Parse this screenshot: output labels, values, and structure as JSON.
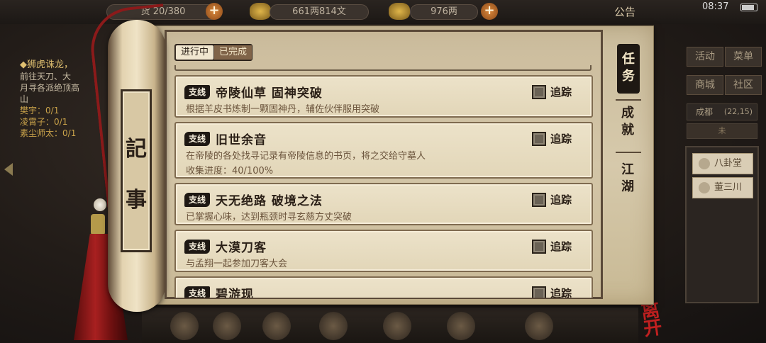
{
  "status_bar": {
    "time": "08:37"
  },
  "hud": {
    "stock_label": "货",
    "stock_value": "20/380",
    "money": "661两814文",
    "gold": "976两",
    "announcement": "公告"
  },
  "left_quest": {
    "title": "◆狮虎诛龙，",
    "desc_lines": [
      "前往天刀、大",
      "月寻各派绝顶高",
      "山"
    ],
    "counters": [
      {
        "label": "樊宇：",
        "value": "0/1"
      },
      {
        "label": "凌霄子：",
        "value": "0/1"
      },
      {
        "label": "素尘师太：",
        "value": "0/1"
      }
    ]
  },
  "right_menu": {
    "buttons": [
      "活动",
      "菜单",
      "商城",
      "社区"
    ],
    "city": "成都",
    "coords": "(22,15)",
    "compass": "未",
    "npcs": [
      "八卦堂",
      "董三川"
    ]
  },
  "leave_label": "离开",
  "scroll": {
    "roller_chars": [
      "記",
      "事"
    ],
    "filter_tabs": {
      "ongoing": "进行中",
      "done": "已完成"
    },
    "category_tabs": {
      "task": "任务",
      "achievement": "成就",
      "jianghu": "江湖"
    },
    "quests": [
      {
        "tag": "支线",
        "name": "帝陵仙草 固神突破",
        "desc": [
          "根据羊皮书炼制一颗固神丹，辅佐伙伴服用突破"
        ],
        "track": "追踪"
      },
      {
        "tag": "支线",
        "name": "旧世余音",
        "desc": [
          "在帝陵的各处找寻记录有帝陵信息的书页，将之交给守墓人",
          "收集进度：40/100%"
        ],
        "track": "追踪"
      },
      {
        "tag": "支线",
        "name": "天无绝路 破境之法",
        "desc": [
          "已掌握心味，达到瓶颈时寻玄慈方丈突破"
        ],
        "track": "追踪"
      },
      {
        "tag": "支线",
        "name": "大漠刀客",
        "desc": [
          "与孟翔一起参加刀客大会"
        ],
        "track": "追踪"
      },
      {
        "tag": "支线",
        "name": "碧游现",
        "desc": [],
        "track": "追踪"
      }
    ]
  }
}
